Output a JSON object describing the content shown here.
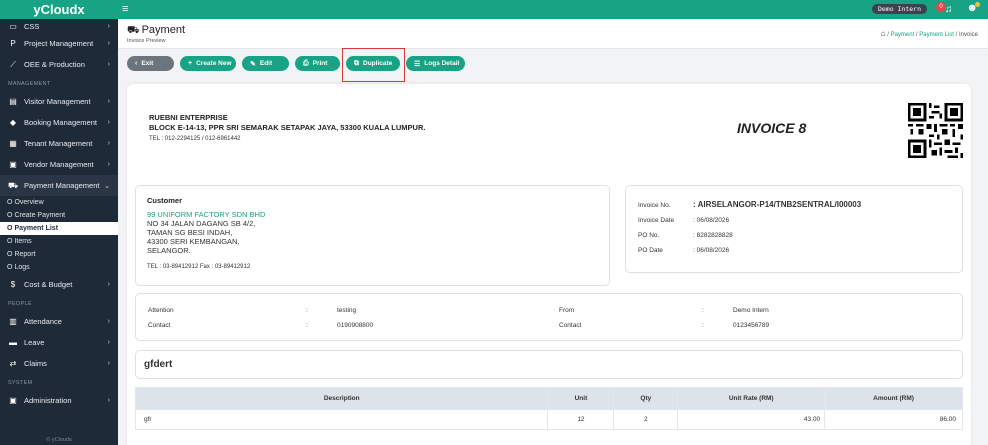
{
  "sidebar": {
    "brand": "yCloudx",
    "top_item": {
      "label": "CSS",
      "icon": "page-icon"
    },
    "items": [
      {
        "label": "Project Management",
        "icon": "project-icon"
      },
      {
        "label": "OEE & Production",
        "icon": "chart-icon"
      }
    ],
    "sections": {
      "management": "MANAGEMENT",
      "people": "PEOPLE",
      "system": "SYSTEM"
    },
    "management_items": [
      {
        "label": "Visitor Management",
        "icon": "id-card-icon"
      },
      {
        "label": "Booking Management",
        "icon": "rocket-icon"
      },
      {
        "label": "Tenant Management",
        "icon": "building-icon"
      },
      {
        "label": "Vendor Management",
        "icon": "vendor-icon"
      },
      {
        "label": "Payment Management",
        "icon": "cart-icon"
      }
    ],
    "payment_sub": [
      "Overview",
      "Create Payment",
      "Payment List",
      "Items",
      "Report",
      "Logs"
    ],
    "cost_budget": {
      "label": "Cost & Budget",
      "icon": "dollar-icon"
    },
    "people_items": [
      {
        "label": "Attendance",
        "icon": "calendar-icon"
      },
      {
        "label": "Leave",
        "icon": "bed-icon"
      },
      {
        "label": "Claims",
        "icon": "exchange-icon"
      }
    ],
    "system_items": [
      {
        "label": "Administration",
        "icon": "admin-icon"
      }
    ],
    "footer": "© yClouds"
  },
  "topbar": {
    "user": "Demo Intern",
    "notification_count": "0"
  },
  "header": {
    "title": "Payment",
    "subtitle": "Invoice Preview",
    "breadcrumb": [
      "Payment",
      "Payment List",
      "Invoice"
    ]
  },
  "toolbar": {
    "exit": "Exit",
    "create_new": "Create New",
    "edit": "Edit",
    "print": "Print",
    "duplicate": "Duplicate",
    "logs_detail": "Logs Detail"
  },
  "invoice": {
    "company_name": "RUEBNI ENTERPRISE",
    "company_address": "BLOCK E-14-13, PPR SRI SEMARAK SETAPAK JAYA, 53300 KUALA LUMPUR.",
    "company_tel": "TEL : 012-2294125 / 012-6961442",
    "heading": "INVOICE 8",
    "customer": {
      "title": "Customer",
      "name": "99 UNIFORM FACTORY SDN BHD",
      "address_lines": [
        "NO 34 JALAN DAGANG SB 4/2,",
        "TAMAN SG BESI INDAH,",
        "43300 SERI KEMBANGAN,",
        "SELANGOR."
      ],
      "tel_fax": "TEL : 03-89412912   Fax : 03-89412912"
    },
    "details": [
      {
        "label": "Invoice No.",
        "value": ":  AIRSELANGOR-P14/TNB2SENTRAL/I00003"
      },
      {
        "label": "Invoice Date",
        "value": ":  06/08/2026"
      },
      {
        "label": "PO No.",
        "value": ":  8282828828"
      },
      {
        "label": "PO Date",
        "value": ":  06/08/2026"
      }
    ],
    "attention": {
      "attention_label": "Attention",
      "attention_value": "testing",
      "contact_label": "Contact",
      "contact_value": "0190908800",
      "from_label": "From",
      "from_value": "Demo Intern",
      "from_contact_label": "Contact",
      "from_contact_value": "0123456789"
    },
    "note": "gfdert",
    "table": {
      "headers": [
        "Description",
        "Unit",
        "Qty",
        "Unit Rate (RM)",
        "Amount (RM)"
      ],
      "rows": [
        [
          "gfr",
          "12",
          "2",
          "43.00",
          "86.00"
        ]
      ]
    }
  }
}
